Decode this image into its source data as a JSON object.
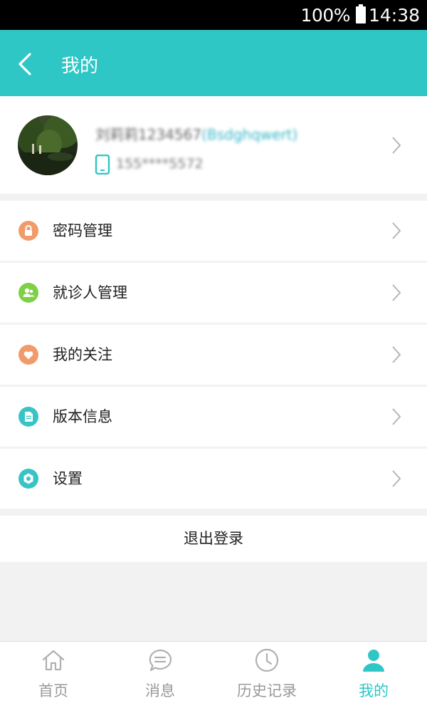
{
  "status_bar": {
    "battery": "100%",
    "time": "14:38"
  },
  "header": {
    "title": "我的"
  },
  "profile": {
    "username": "刘莉莉1234567",
    "username_tag": "(Bsdghqwert)",
    "phone": "155****5572"
  },
  "menu": [
    {
      "label": "密码管理",
      "icon": "lock-icon",
      "color": "#f29b6a"
    },
    {
      "label": "就诊人管理",
      "icon": "patients-icon",
      "color": "#7ed044"
    },
    {
      "label": "我的关注",
      "icon": "heart-icon",
      "color": "#f29b6a"
    },
    {
      "label": "版本信息",
      "icon": "document-icon",
      "color": "#36c4c7"
    },
    {
      "label": "设置",
      "icon": "settings-icon",
      "color": "#36c4c7"
    }
  ],
  "logout_label": "退出登录",
  "tabs": [
    {
      "label": "首页",
      "icon": "home-icon",
      "active": false
    },
    {
      "label": "消息",
      "icon": "message-icon",
      "active": false
    },
    {
      "label": "历史记录",
      "icon": "clock-icon",
      "active": false
    },
    {
      "label": "我的",
      "icon": "user-icon",
      "active": true
    }
  ],
  "colors": {
    "primary": "#2fc6c6",
    "background": "#f2f2f2",
    "inactive": "#9a9a9a"
  }
}
